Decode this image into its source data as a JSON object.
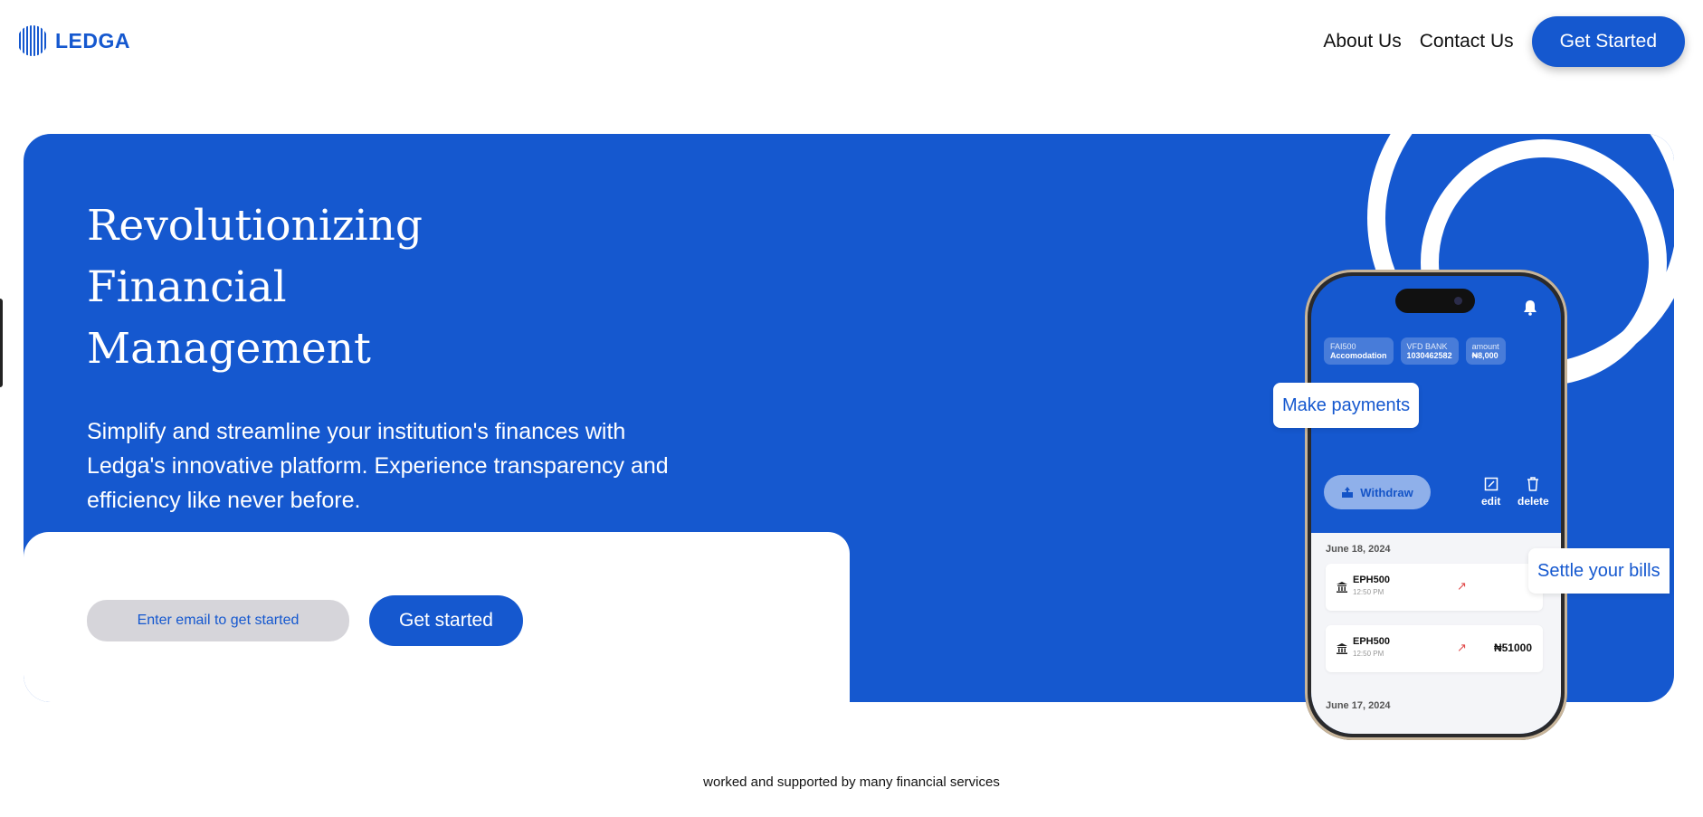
{
  "header": {
    "logo_text": "LEDGA",
    "nav": [
      "About Us",
      "Contact Us"
    ],
    "cta_label": "Get Started"
  },
  "hero": {
    "title_lines": [
      "Revolutionizing",
      "Financial",
      "Management"
    ],
    "subtitle": "Simplify and streamline your institution's finances with Ledga's innovative platform. Experience transparency and efficiency like never before.",
    "email_placeholder": "Enter email to get started",
    "cta_label": "Get started"
  },
  "callouts": {
    "payments": "Make payments",
    "bills": "Settle your bills"
  },
  "phone": {
    "chips": [
      {
        "label": "FAI500",
        "value": "Accomodation"
      },
      {
        "label": "VFD BANK",
        "value": "1030462582"
      },
      {
        "label": "amount",
        "value": "₦8,000"
      }
    ],
    "withdraw_label": "Withdraw",
    "edit_label": "edit",
    "delete_label": "delete",
    "groups": [
      {
        "date": "June 18, 2024",
        "transactions": [
          {
            "name": "EPH500",
            "time": "12:50 PM",
            "amount": ""
          },
          {
            "name": "EPH500",
            "time": "12:50 PM",
            "amount": "₦51000"
          }
        ]
      },
      {
        "date": "June 17, 2024"
      }
    ]
  },
  "footer": {
    "text": "worked and supported by many financial services"
  },
  "colors": {
    "brand": "#1558cf",
    "input_bg": "#d6d5da",
    "arrow": "#e04a4a"
  }
}
